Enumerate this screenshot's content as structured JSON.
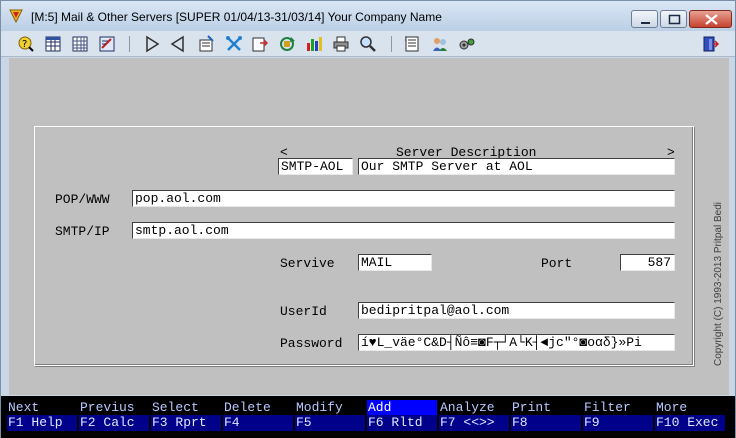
{
  "window": {
    "title": "[M:5]  Mail & Other Servers  [SUPER  01/04/13-31/03/14]  Your Company Name"
  },
  "toolbar": {
    "icons": [
      "help-icon",
      "grid-icon",
      "table-icon",
      "edit-form-icon",
      "play-next-icon",
      "play-back-icon",
      "new-record-icon",
      "tools-icon",
      "export-icon",
      "refresh-icon",
      "bar-chart-icon",
      "printer-icon",
      "search-icon",
      "notes-icon",
      "users-icon",
      "settings-icon",
      "exit-icon"
    ]
  },
  "form": {
    "server_desc_header": "Server Description",
    "nav_left": "<",
    "nav_right": ">",
    "server_code": "SMTP-AOL",
    "server_description": "Our SMTP Server at AOL",
    "pop_label": "POP/WWW",
    "pop_value": "pop.aol.com",
    "smtp_label": "SMTP/IP",
    "smtp_value": "smtp.aol.com",
    "service_label": "Servive",
    "service_value": "MAIL",
    "port_label": "Port",
    "port_value": "587",
    "userid_label": "UserId",
    "userid_value": "bedipritpal@aol.com",
    "password_label": "Password",
    "password_value": "í♥L_väe°C&D┤Ñô≡◙F┬┘A└K┤◄jc\"°◙oαδ}»Pi"
  },
  "copyright": "Copyright (C) 1993-2013 Pritpal Bedi",
  "fkeys": [
    {
      "top": "Next",
      "bottom": "F1 Help"
    },
    {
      "top": "Previus",
      "bottom": "F2 Calc"
    },
    {
      "top": "Select",
      "bottom": "F3 Rprt"
    },
    {
      "top": "Delete",
      "bottom": "F4"
    },
    {
      "top": "Modify",
      "bottom": "F5"
    },
    {
      "top": "Add",
      "bottom": "F6 Rltd"
    },
    {
      "top": "Analyze",
      "bottom": "F7 <<>>"
    },
    {
      "top": "Print",
      "bottom": "F8"
    },
    {
      "top": "Filter",
      "bottom": "F9"
    },
    {
      "top": "More",
      "bottom": "F10 Exec"
    }
  ],
  "colors": {
    "fkey_active": "#0000ff",
    "fkey_bottom": "#00008b",
    "client_bg": "#c0c0c0"
  }
}
